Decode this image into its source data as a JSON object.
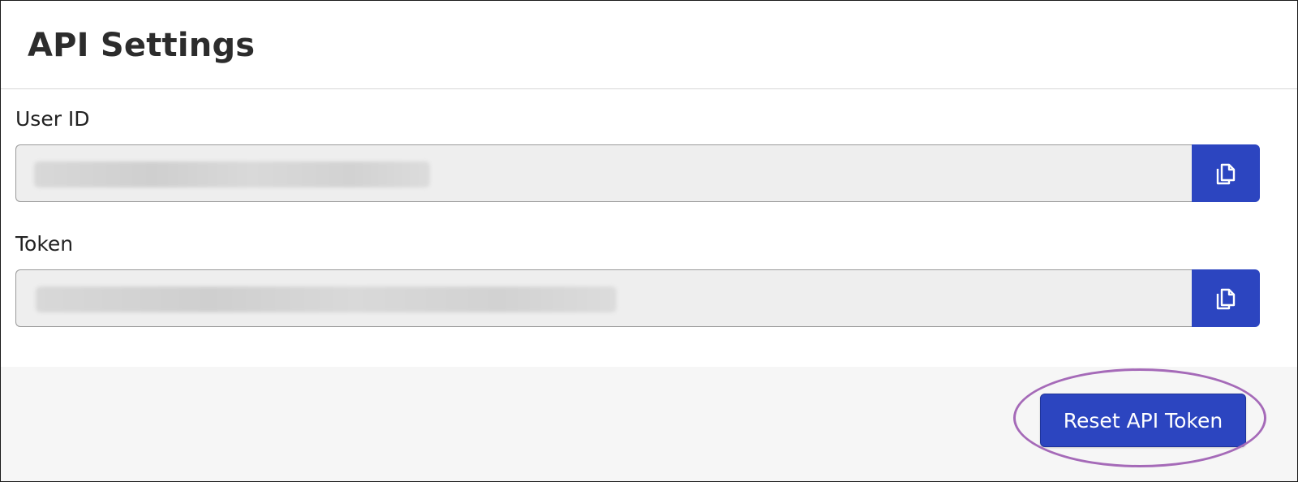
{
  "header": {
    "title": "API Settings"
  },
  "fields": {
    "user_id": {
      "label": "User ID",
      "value": "",
      "copy_icon": "copy-icon"
    },
    "token": {
      "label": "Token",
      "value": "",
      "copy_icon": "copy-icon"
    }
  },
  "footer": {
    "reset_label": "Reset API Token"
  },
  "colors": {
    "primary": "#2c45c0",
    "input_background": "#eeeeee",
    "footer_background": "#f6f6f6",
    "highlight_ring": "#a56ab8",
    "title_text": "#2c2c2c"
  }
}
